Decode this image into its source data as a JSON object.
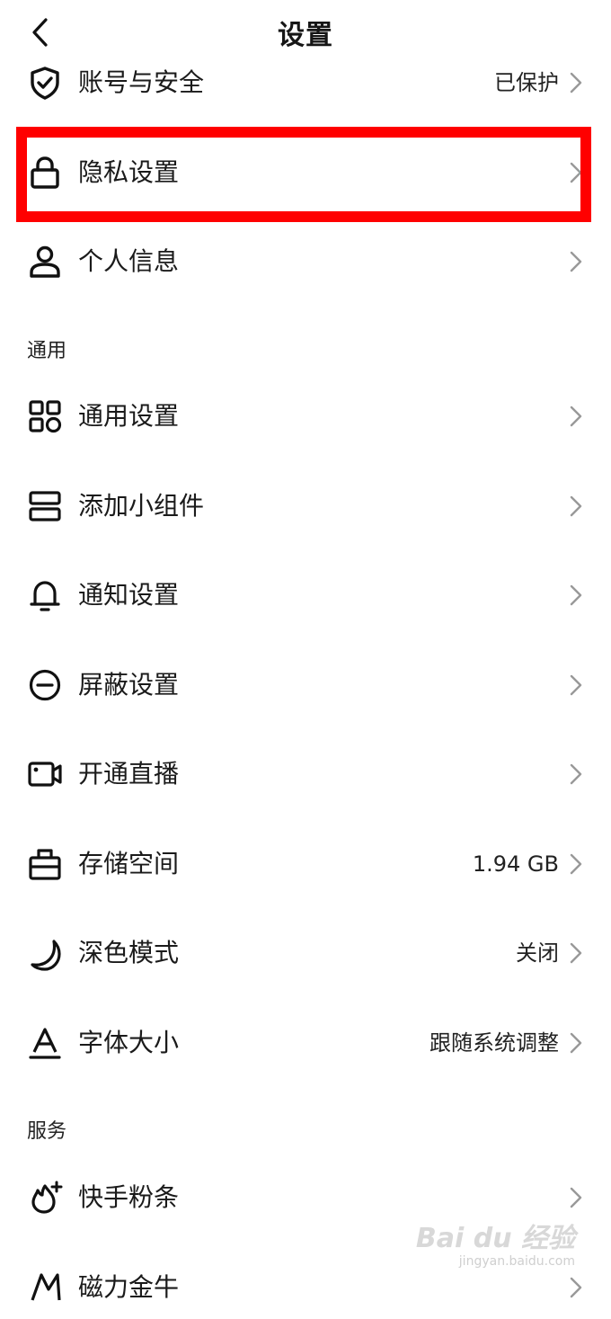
{
  "header": {
    "title": "设置"
  },
  "account": [
    {
      "icon": "shield-check-icon",
      "label": "账号与安全",
      "value": "已保护"
    },
    {
      "icon": "lock-icon",
      "label": "隐私设置",
      "value": ""
    },
    {
      "icon": "person-icon",
      "label": "个人信息",
      "value": ""
    }
  ],
  "sections": {
    "general": "通用",
    "services": "服务"
  },
  "general": [
    {
      "icon": "grid-icon",
      "label": "通用设置",
      "value": ""
    },
    {
      "icon": "widget-icon",
      "label": "添加小组件",
      "value": ""
    },
    {
      "icon": "bell-icon",
      "label": "通知设置",
      "value": ""
    },
    {
      "icon": "minus-circle-icon",
      "label": "屏蔽设置",
      "value": ""
    },
    {
      "icon": "video-camera-icon",
      "label": "开通直播",
      "value": ""
    },
    {
      "icon": "storage-icon",
      "label": "存储空间",
      "value": "1.94 GB"
    },
    {
      "icon": "moon-icon",
      "label": "深色模式",
      "value": "关闭"
    },
    {
      "icon": "font-size-icon",
      "label": "字体大小",
      "value": "跟随系统调整"
    }
  ],
  "services": [
    {
      "icon": "flame-plus-icon",
      "label": "快手粉条",
      "value": ""
    },
    {
      "icon": "magnet-icon",
      "label": "磁力金牛",
      "value": ""
    }
  ],
  "watermark": {
    "brand": "Bai du 经验",
    "url": "jingyan.baidu.com"
  }
}
